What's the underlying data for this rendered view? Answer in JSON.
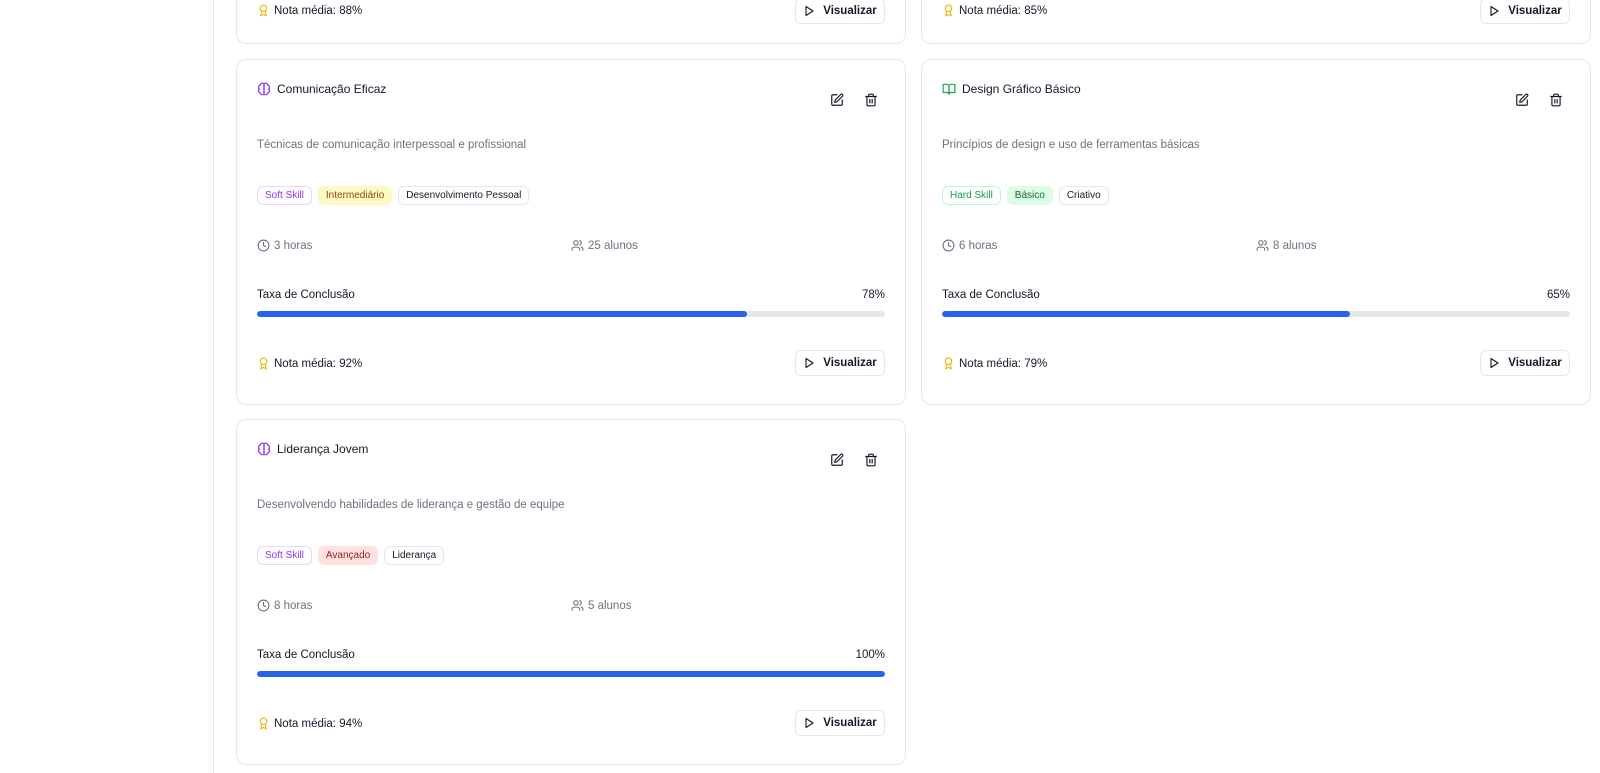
{
  "top_cards": [
    {
      "score_label": "Nota média: 88%",
      "view_label": "Visualizar"
    },
    {
      "score_label": "Nota média: 85%",
      "view_label": "Visualizar"
    }
  ],
  "cards": [
    {
      "title": "Comunicação Eficaz",
      "title_icon": "brain-icon",
      "description": "Técnicas de comunicação interpessoal e profissional",
      "tags": {
        "skill": "Soft Skill",
        "level": "Intermediário",
        "category": "Desenvolvimento Pessoal"
      },
      "duration": "3 horas",
      "students": "25 alunos",
      "progress_label": "Taxa de Conclusão",
      "progress_value": "78%",
      "progress_fraction": 0.78,
      "score_label": "Nota média: 92%",
      "view_label": "Visualizar"
    },
    {
      "title": "Design Gráfico Básico",
      "title_icon": "book-open-icon",
      "description": "Princípios de design e uso de ferramentas básicas",
      "tags": {
        "skill": "Hard Skill",
        "level": "Básico",
        "category": "Criativo"
      },
      "duration": "6 horas",
      "students": "8 alunos",
      "progress_label": "Taxa de Conclusão",
      "progress_value": "65%",
      "progress_fraction": 0.65,
      "score_label": "Nota média: 79%",
      "view_label": "Visualizar"
    },
    {
      "title": "Liderança Jovem",
      "title_icon": "brain-icon",
      "description": "Desenvolvendo habilidades de liderança e gestão de equipe",
      "tags": {
        "skill": "Soft Skill",
        "level": "Avançado",
        "category": "Liderança"
      },
      "duration": "8 horas",
      "students": "5 alunos",
      "progress_label": "Taxa de Conclusão",
      "progress_value": "100%",
      "progress_fraction": 1.0,
      "score_label": "Nota média: 94%",
      "view_label": "Visualizar"
    }
  ],
  "colors": {
    "primary": "#2563eb",
    "soft_skill": "#9333ea",
    "hard_skill": "#16a34a",
    "award": "#eab308"
  }
}
